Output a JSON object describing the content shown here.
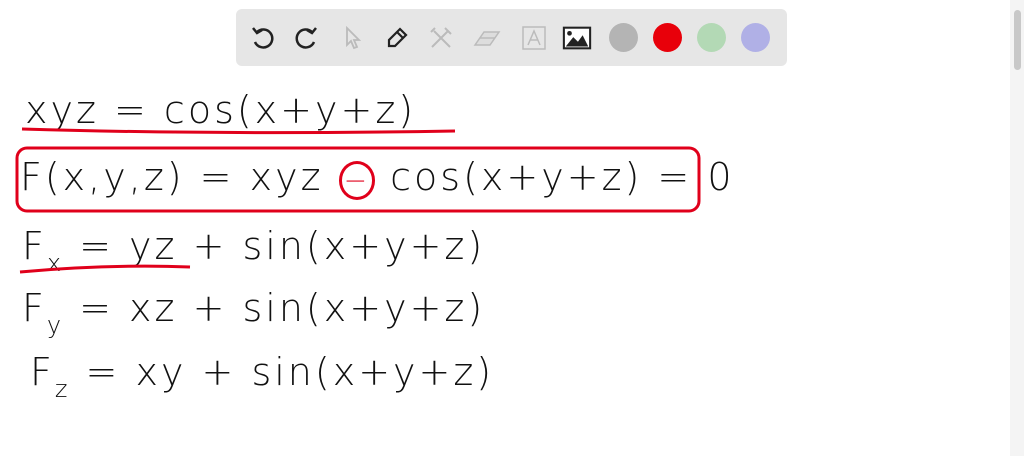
{
  "toolbar": {
    "tools": [
      "undo-icon",
      "redo-icon",
      "select-icon",
      "pen-icon",
      "tools-icon",
      "eraser-icon",
      "text-icon",
      "image-icon"
    ],
    "colors": {
      "gray": "#b4b4b4",
      "red": "#e8000a",
      "green": "#b3d9b5",
      "blue": "#b0b0e6"
    }
  },
  "board": {
    "line1": "xyz = cos(x+y+z)",
    "line2_a": "F(x,y,z) = xyz ",
    "line2_op": "−",
    "line2_b": " cos(x+y+z) = 0",
    "line3_a": "F",
    "line3_sub": "x",
    "line3_b": " = yz + sin(x+y+z)",
    "line4_a": "F",
    "line4_sub": "y",
    "line4_b": " = xz + sin(x+y+z)",
    "line5_a": "F",
    "line5_sub": "z",
    "line5_b": " = xy + sin(x+y+z)",
    "accent": "#e0001b"
  }
}
